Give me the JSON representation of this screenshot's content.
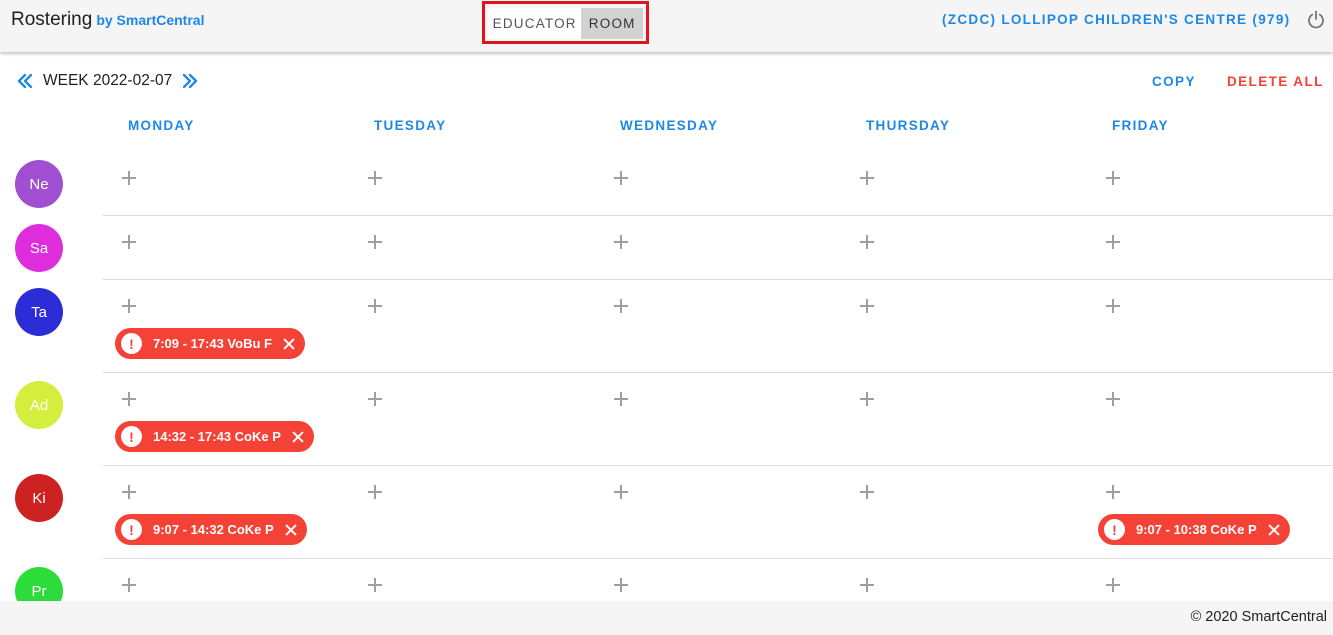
{
  "header": {
    "app_title": "Rostering",
    "app_by": "by SmartCentral",
    "modes": [
      {
        "label": "EDUCATOR",
        "selected": false
      },
      {
        "label": "ROOM",
        "selected": true
      }
    ],
    "centre": "(ZCDC) LOLLIPOP CHILDREN'S CENTRE (979)",
    "power_icon": "power-icon"
  },
  "week": {
    "label": "WEEK 2022-02-07",
    "prev_icon": "chevron-double-left-icon",
    "next_icon": "chevron-double-right-icon",
    "copy_label": "COPY",
    "delete_all_label": "DELETE ALL"
  },
  "days": [
    "MONDAY",
    "TUESDAY",
    "WEDNESDAY",
    "THURSDAY",
    "FRIDAY"
  ],
  "rows": [
    {
      "initials": "Ne",
      "color": "#a04ed2",
      "shifts": []
    },
    {
      "initials": "Sa",
      "color": "#de2edb",
      "shifts": []
    },
    {
      "initials": "Ta",
      "color": "#2d2dd8",
      "shifts": [
        {
          "day": 0,
          "label": "7:09 - 17:43 VoBu F"
        }
      ]
    },
    {
      "initials": "Ad",
      "color": "#d4ee3e",
      "shifts": [
        {
          "day": 0,
          "label": "14:32 - 17:43 CoKe P"
        }
      ]
    },
    {
      "initials": "Ki",
      "color": "#cc2222",
      "shifts": [
        {
          "day": 0,
          "label": "9:07 - 14:32 CoKe P"
        },
        {
          "day": 4,
          "label": "9:07 - 10:38 CoKe P"
        }
      ]
    },
    {
      "initials": "Pr",
      "color": "#2bdc3a",
      "shifts": []
    }
  ],
  "footer": {
    "text": "© 2020 SmartCentral"
  },
  "colors": {
    "accent": "#1e88e5",
    "danger": "#f44336",
    "highlight_border": "#e0141e"
  }
}
